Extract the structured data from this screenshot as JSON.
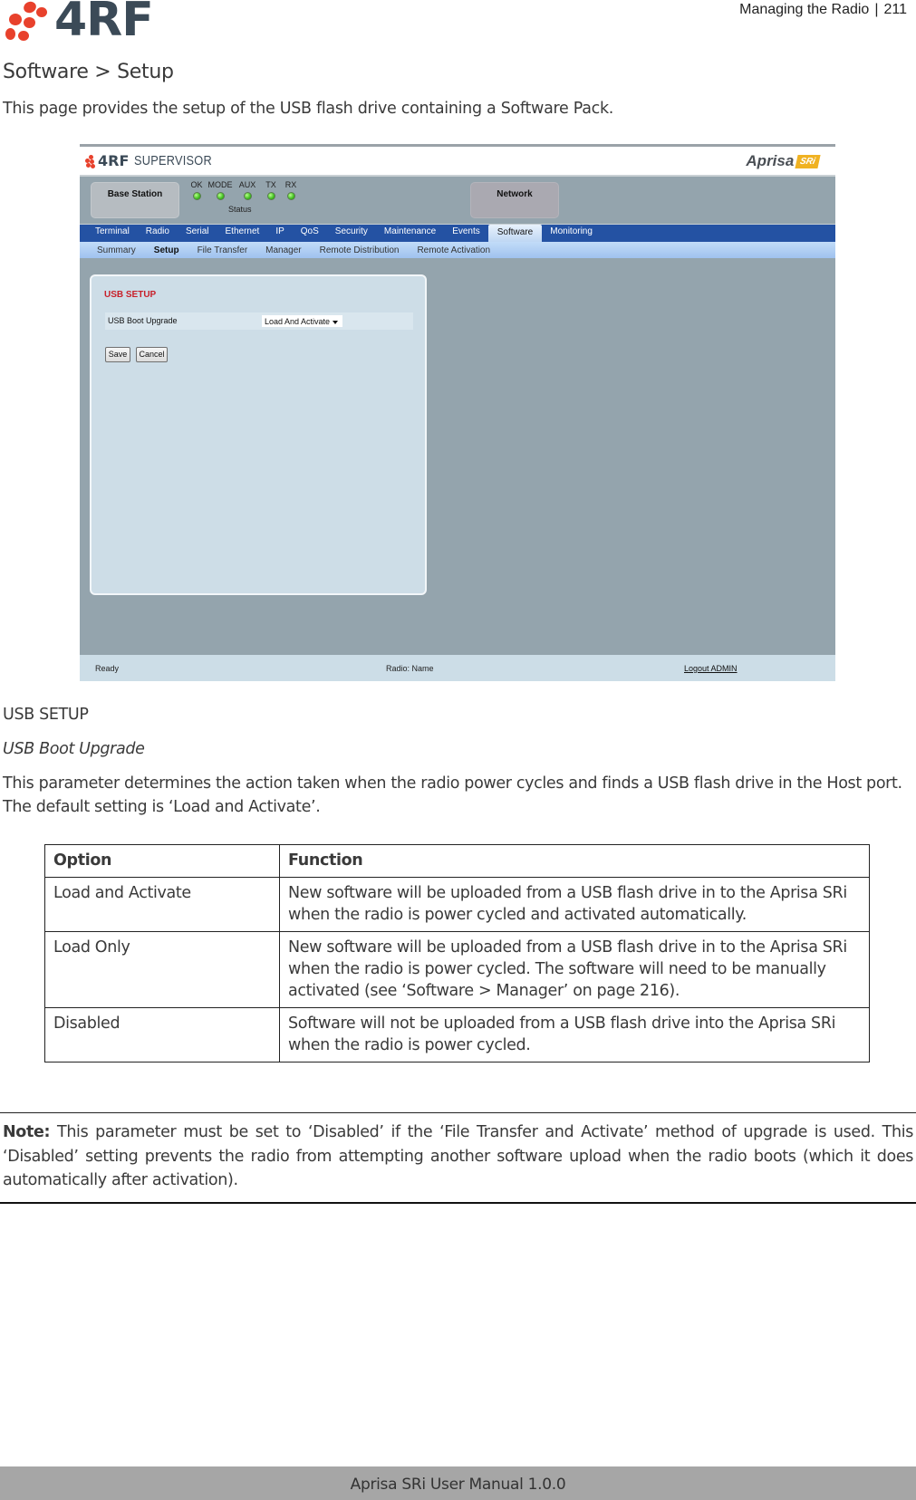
{
  "document": {
    "brand": "4RF",
    "header_section": "Managing the Radio",
    "header_separator": "|",
    "page_number": "211",
    "section_title": "Software > Setup",
    "intro": "This page provides the setup of the USB flash drive containing a Software Pack.",
    "footer": "Aprisa SRi User Manual 1.0.0"
  },
  "screenshot": {
    "app": {
      "brand": "4RF",
      "product": "SUPERVISOR",
      "device_name": "Aprisa",
      "device_badge": "SRi"
    },
    "station_label": "Base Station",
    "network_label": "Network",
    "leds": [
      {
        "label": "OK",
        "state": "green"
      },
      {
        "label": "MODE",
        "state": "green"
      },
      {
        "label": "AUX",
        "state": "green"
      },
      {
        "label": "TX",
        "state": "green"
      },
      {
        "label": "RX",
        "state": "green"
      }
    ],
    "status_label": "Status",
    "main_tabs": [
      {
        "label": "Terminal",
        "active": false
      },
      {
        "label": "Radio",
        "active": false
      },
      {
        "label": "Serial",
        "active": false
      },
      {
        "label": "Ethernet",
        "active": false
      },
      {
        "label": "IP",
        "active": false
      },
      {
        "label": "QoS",
        "active": false
      },
      {
        "label": "Security",
        "active": false
      },
      {
        "label": "Maintenance",
        "active": false
      },
      {
        "label": "Events",
        "active": false
      },
      {
        "label": "Software",
        "active": true
      },
      {
        "label": "Monitoring",
        "active": false
      }
    ],
    "sub_tabs": [
      {
        "label": "Summary",
        "active": false
      },
      {
        "label": "Setup",
        "active": true
      },
      {
        "label": "File Transfer",
        "active": false
      },
      {
        "label": "Manager",
        "active": false
      },
      {
        "label": "Remote Distribution",
        "active": false
      },
      {
        "label": "Remote Activation",
        "active": false
      }
    ],
    "panel": {
      "title": "USB SETUP",
      "param_label": "USB Boot Upgrade",
      "param_value": "Load And Activate",
      "save_label": "Save",
      "cancel_label": "Cancel"
    },
    "status_bar": {
      "state": "Ready",
      "radio": "Radio: Name",
      "logout": "Logout ADMIN"
    }
  },
  "content": {
    "heading": "USB SETUP",
    "param_heading": "USB Boot Upgrade",
    "paragraph": "This parameter determines the action taken when the radio power cycles and finds a USB flash drive in the Host port. The default setting is ‘Load and Activate’.",
    "table": {
      "headers": [
        "Option",
        "Function"
      ],
      "rows": [
        [
          "Load and Activate",
          "New software will be uploaded from a USB flash drive in to the Aprisa SRi when the radio is power cycled and activated automatically."
        ],
        [
          "Load Only",
          "New software will be uploaded from a USB flash drive in to the Aprisa SRi when the radio is power cycled. The software will need to be manually activated (see ‘Software > Manager’ on page 216)."
        ],
        [
          "Disabled",
          "Software will not be uploaded from a USB flash drive into the Aprisa SRi when the radio is power cycled."
        ]
      ]
    },
    "note_label": "Note:",
    "note_text": " This parameter must be set to ‘Disabled’ if the ‘File Transfer and Activate’ method of upgrade is used. This ‘Disabled’ setting prevents the radio from attempting another software upload when the radio boots (which it does automatically after activation)."
  },
  "colors": {
    "logo_red": "#e8412c",
    "logo_slate": "#3b4a57",
    "nav_blue": "#2452a3",
    "panel_title_red": "#c8202a",
    "led_green": "#3fbf20",
    "footer_gray": "#a6a6a6"
  }
}
